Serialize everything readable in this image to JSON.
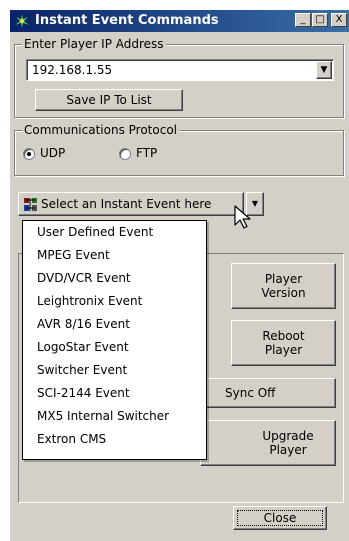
{
  "window": {
    "title": "Instant Event Commands"
  },
  "title_buttons": {
    "minimize": "_",
    "maximize": "□",
    "close": "X"
  },
  "ip_group": {
    "legend": "Enter Player IP Address",
    "ip_value": "192.168.1.55",
    "save_button": "Save IP To List"
  },
  "protocol_group": {
    "legend": "Communications Protocol",
    "options": [
      {
        "label": "UDP",
        "selected": true
      },
      {
        "label": "FTP",
        "selected": false
      }
    ]
  },
  "event_dropdown": {
    "label": "Select an Instant Event here",
    "items": [
      "User Defined Event",
      "MPEG Event",
      "DVD/VCR Event",
      "Leightronix Event",
      "AVR 8/16 Event",
      "LogoStar Event",
      "Switcher Event",
      "SCI-2144 Event",
      "MX5 Internal Switcher",
      "Extron CMS"
    ]
  },
  "buttons": {
    "player_version": "Player\nVersion",
    "reboot_player": "Reboot\nPlayer",
    "sync_off": "Sync Off",
    "upgrade_player": "Upgrade\nPlayer",
    "close": "Close"
  },
  "colors": {
    "face": "#d4d0c8",
    "title_start": "#0a246a",
    "title_end": "#3a6ea5"
  }
}
